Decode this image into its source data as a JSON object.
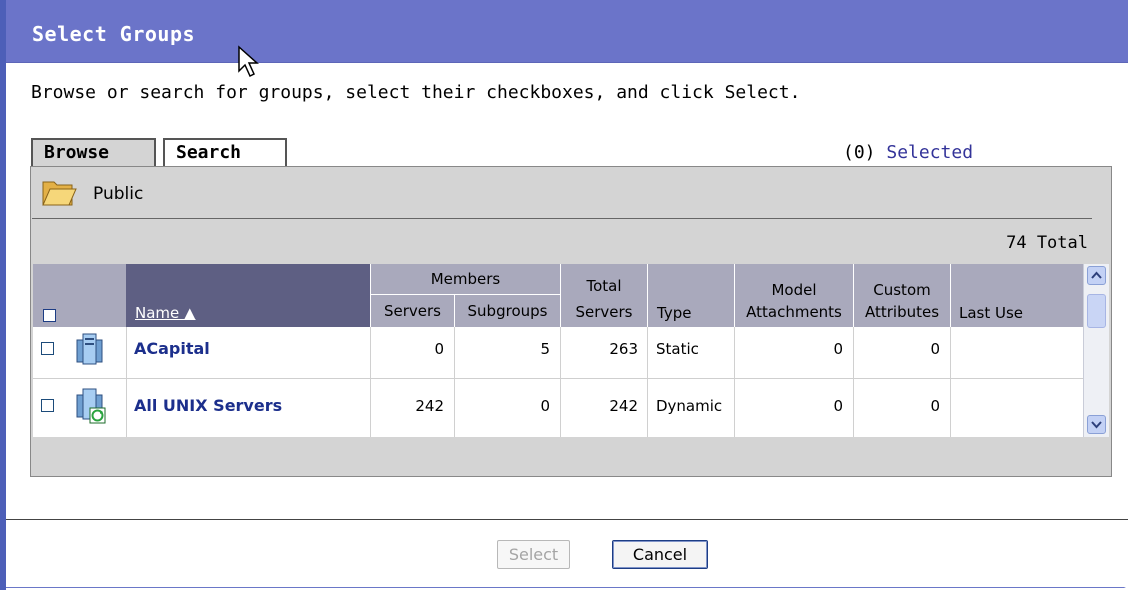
{
  "dialog": {
    "title": "Select Groups",
    "instructions": "Browse or search for groups, select their checkboxes, and click Select."
  },
  "tabs": [
    {
      "label": "Browse",
      "active": true
    },
    {
      "label": "Search",
      "active": false
    }
  ],
  "selection": {
    "count": "(0)",
    "label": "Selected"
  },
  "folder": {
    "label": "Public",
    "icon": "folder-open-icon"
  },
  "total": "74 Total",
  "table": {
    "headers": {
      "name": "Name ▲",
      "members": "Members",
      "servers": "Servers",
      "subgroups": "Subgroups",
      "total_servers_1": "Total",
      "total_servers_2": "Servers",
      "type": "Type",
      "model_1": "Model",
      "model_2": "Attachments",
      "custom_1": "Custom",
      "custom_2": "Attributes",
      "last_use": "Last Use"
    },
    "rows": [
      {
        "name": "ACapital",
        "servers": "0",
        "subgroups": "5",
        "total_servers": "263",
        "type": "Static",
        "model_attachments": "0",
        "custom_attributes": "0",
        "last_use": "",
        "icon": "static-group-icon"
      },
      {
        "name": "All UNIX Servers",
        "servers": "242",
        "subgroups": "0",
        "total_servers": "242",
        "type": "Dynamic",
        "model_attachments": "0",
        "custom_attributes": "0",
        "last_use": "",
        "icon": "dynamic-group-icon"
      }
    ]
  },
  "buttons": {
    "select": "Select",
    "cancel": "Cancel"
  },
  "colors": {
    "titlebar": "#6b74c9",
    "link": "#1c2f8c",
    "header": "#a9a9bc",
    "header_sorted": "#5e5f83"
  }
}
